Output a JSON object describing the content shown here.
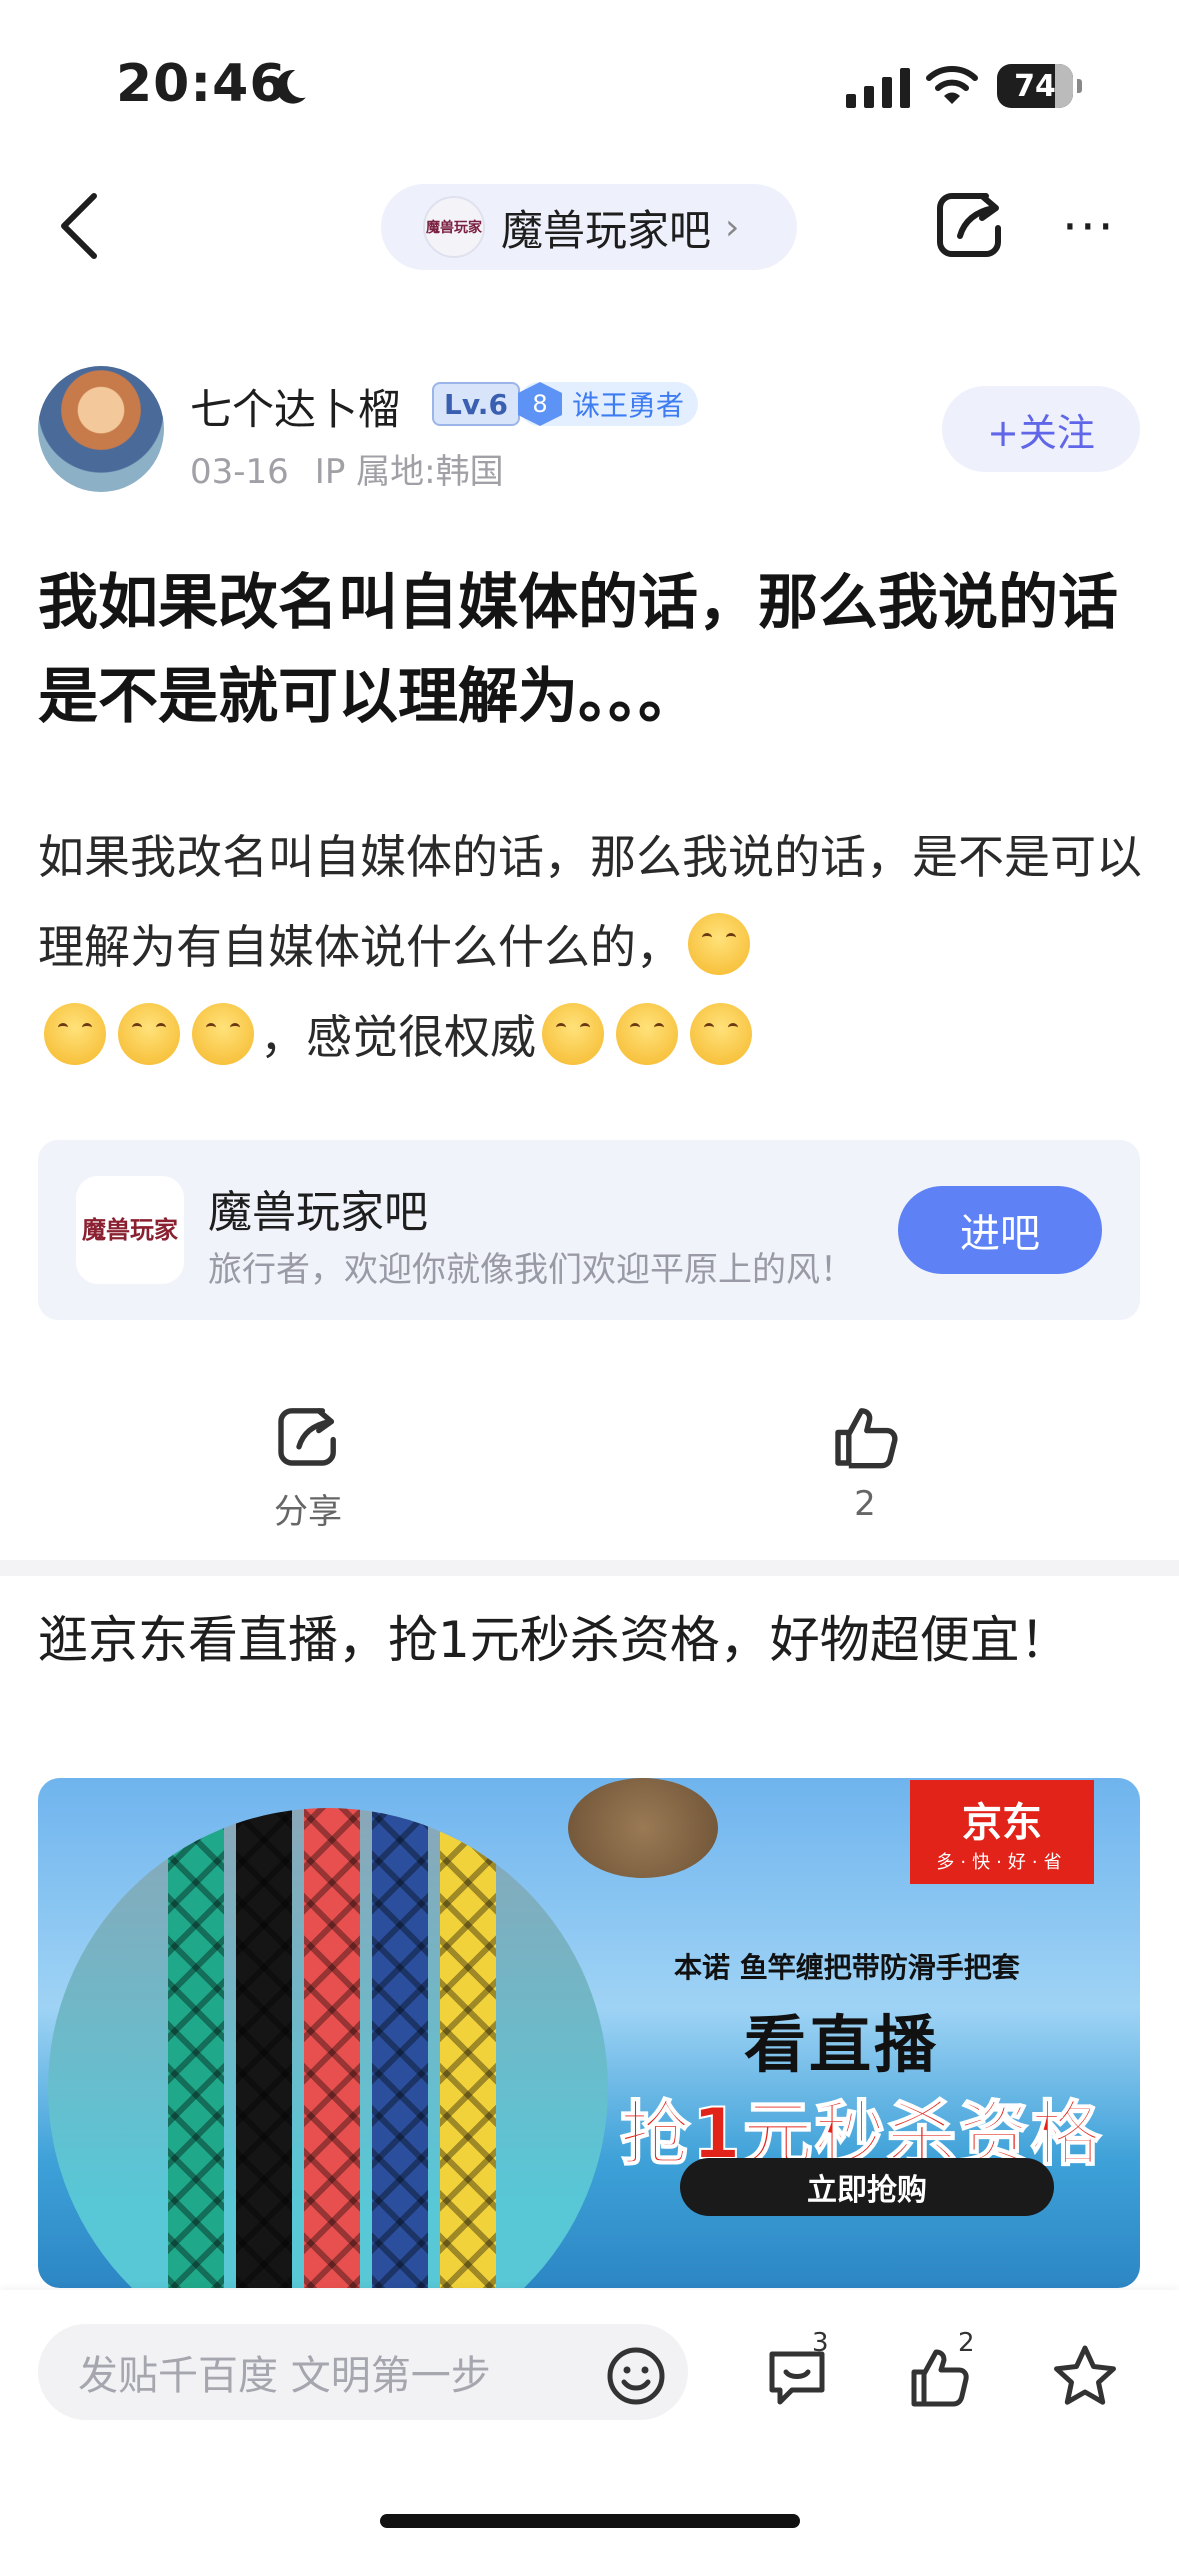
{
  "status_bar": {
    "time": "20:46",
    "battery": "74"
  },
  "nav": {
    "forum_name": "魔兽玩家吧",
    "forum_logo_text": "魔兽玩家"
  },
  "author": {
    "name": "七个达卜榴",
    "level": "Lv.6",
    "badge_number": "8",
    "badge_title": "诛王勇者",
    "date": "03-16",
    "ip_location": "IP 属地:韩国",
    "follow_label": "+关注"
  },
  "post": {
    "title": "我如果改名叫自媒体的话，那么我说的话是不是就可以理解为。。。",
    "body_text_1": "如果我改名叫自媒体的话，那么我说的话，是不是可以理解为有自媒体说什么什么的，",
    "body_text_2": "，感觉很权威",
    "emoji_name": "shy-giggle-emoji"
  },
  "forum_card": {
    "name": "魔兽玩家吧",
    "slogan": "旅行者，欢迎你就像我们欢迎平原上的风！",
    "enter_label": "进吧",
    "logo_text": "魔兽玩家"
  },
  "actions": {
    "share_label": "分享",
    "like_count": "2"
  },
  "ad": {
    "title": "逛京东看直播，抢1元秒杀资格，好物超便宜！",
    "brand": "京东",
    "brand_slogan": "多·快·好·省",
    "product": "本诺 鱼竿缠把带防滑手把套",
    "headline": "看直播",
    "offer": "抢1元秒杀资格",
    "button": "立即抢购",
    "strip_colors": [
      "#1fa889",
      "#151515",
      "#e8504f",
      "#2b4f9c",
      "#f2d23a"
    ]
  },
  "bottom_bar": {
    "reply_placeholder": "发贴千百度 文明第一步",
    "comment_count": "3",
    "like_count": "2"
  }
}
